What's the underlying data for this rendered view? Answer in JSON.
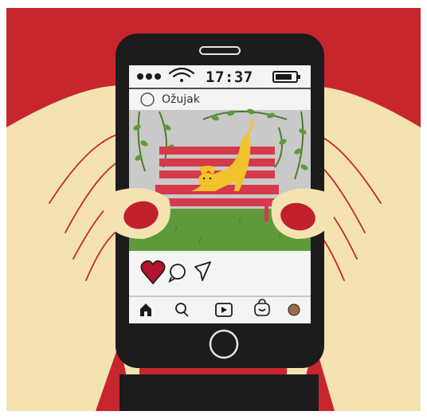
{
  "status_bar": {
    "time": "17:37",
    "signal_icon": "signal-dots-icon",
    "wifi_icon": "wifi-icon",
    "battery_icon": "battery-icon"
  },
  "post": {
    "username": "Ožujak",
    "avatar": "avatar-circle",
    "image": "cat-stretching-on-park-bench",
    "liked": true
  },
  "actions": [
    {
      "name": "like",
      "icon": "heart-icon"
    },
    {
      "name": "comment",
      "icon": "comment-bubble-icon"
    },
    {
      "name": "share",
      "icon": "paper-plane-icon"
    }
  ],
  "nav": [
    {
      "name": "home",
      "icon": "home-icon"
    },
    {
      "name": "search",
      "icon": "search-icon"
    },
    {
      "name": "reels",
      "icon": "play-icon"
    },
    {
      "name": "shop",
      "icon": "shop-bag-icon"
    },
    {
      "name": "profile",
      "icon": "profile-avatar-icon"
    }
  ],
  "colors": {
    "background_red": "#c8262f",
    "skin": "#f4e3b1",
    "phone": "#1c1c1c",
    "nail": "#c11f2b",
    "bench": "#d6394a",
    "grass": "#5e9a3a",
    "cat": "#f1c42b",
    "heart": "#b1142a",
    "photo_sky": "#c9c9c9"
  }
}
